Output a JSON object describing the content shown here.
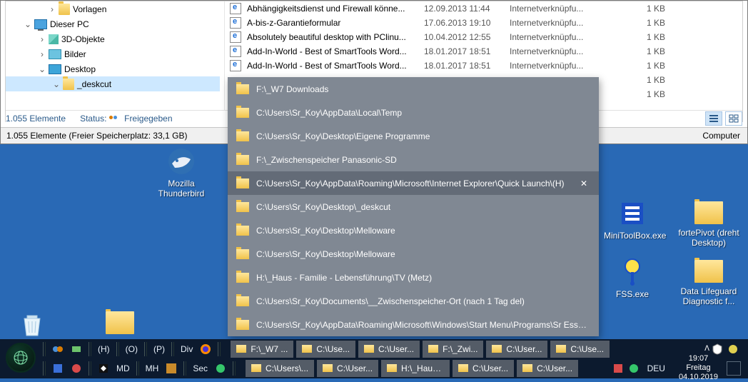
{
  "tree": [
    {
      "indent": 58,
      "exp": "›",
      "icon": "folder",
      "label": "Vorlagen"
    },
    {
      "indent": 24,
      "exp": "⌄",
      "icon": "pc",
      "label": "Dieser PC"
    },
    {
      "indent": 44,
      "exp": "›",
      "icon": "cube",
      "label": "3D-Objekte"
    },
    {
      "indent": 44,
      "exp": "›",
      "icon": "pic",
      "label": "Bilder"
    },
    {
      "indent": 44,
      "exp": "⌄",
      "icon": "desk",
      "label": "Desktop"
    },
    {
      "indent": 64,
      "exp": "⌄",
      "icon": "folder",
      "label": "_deskcut",
      "sel": true
    }
  ],
  "files": [
    {
      "name": "Abhängigkeitsdienst und Firewall könne...",
      "date": "12.09.2013 11:44",
      "type": "Internetverknüpfu...",
      "size": "1 KB"
    },
    {
      "name": "A-bis-z-Garantieformular",
      "date": "17.06.2013 19:10",
      "type": "Internetverknüpfu...",
      "size": "1 KB"
    },
    {
      "name": "Absolutely beautiful desktop with PClinu...",
      "date": "10.04.2012 12:55",
      "type": "Internetverknüpfu...",
      "size": "1 KB"
    },
    {
      "name": "Add-In-World - Best of SmartTools Word...",
      "date": "18.01.2017 18:51",
      "type": "Internetverknüpfu...",
      "size": "1 KB"
    },
    {
      "name": "Add-In-World - Best of SmartTools Word...",
      "date": "18.01.2017 18:51",
      "type": "Internetverknüpfu...",
      "size": "1 KB"
    },
    {
      "name": "",
      "date": "",
      "type": "",
      "size": "1 KB"
    },
    {
      "name": "",
      "date": "",
      "type": "",
      "size": "1 KB"
    }
  ],
  "status": {
    "count": "1.055 Elemente",
    "status_label": "Status:",
    "status_val": "Freigegeben"
  },
  "bottombar": {
    "left": "1.055 Elemente (Freier Speicherplatz: 33,1 GB)",
    "right": "Computer"
  },
  "popup": [
    {
      "label": "F:\\_W7 Downloads"
    },
    {
      "label": "C:\\Users\\Sr_Koy\\AppData\\Local\\Temp"
    },
    {
      "label": "C:\\Users\\Sr_Koy\\Desktop\\Eigene Programme"
    },
    {
      "label": "F:\\_Zwischenspeicher Panasonic-SD"
    },
    {
      "label": "C:\\Users\\Sr_Koy\\AppData\\Roaming\\Microsoft\\Internet Explorer\\Quick Launch\\(H)",
      "hov": true,
      "close": true
    },
    {
      "label": "C:\\Users\\Sr_Koy\\Desktop\\_deskcut"
    },
    {
      "label": "C:\\Users\\Sr_Koy\\Desktop\\Melloware"
    },
    {
      "label": "C:\\Users\\Sr_Koy\\Desktop\\Melloware"
    },
    {
      "label": "H:\\_Haus - Familie - Lebensführung\\TV (Metz)"
    },
    {
      "label": "C:\\Users\\Sr_Koy\\Documents\\__Zwischenspeicher-Ort (nach 1 Tag del)"
    },
    {
      "label": "C:\\Users\\Sr_Koy\\AppData\\Roaming\\Microsoft\\Windows\\Start Menu\\Programs\\Sr Essen..."
    }
  ],
  "desktop": {
    "thunderbird": "Mozilla Thunderbird",
    "minitool": "MiniToolBox.exe",
    "fortepivot": "fortePivot (dreht Desktop)",
    "fss": "FSS.exe",
    "datalife": "Data Lifeguard Diagnostic f..."
  },
  "taskbar": {
    "row1_texts": [
      "(H)",
      "(O)",
      "(P)",
      "Div"
    ],
    "row2_texts": [
      "MD",
      "MH",
      " ",
      "Sec"
    ],
    "folders1": [
      "F:\\_W7 ...",
      "C:\\Use...",
      "C:\\User...",
      "F:\\_Zwi...",
      "C:\\User...",
      "C:\\Use..."
    ],
    "folders2": [
      "C:\\Users\\...",
      "C:\\User...",
      "H:\\_Haus ...",
      "C:\\User...",
      "C:\\User..."
    ],
    "lang": "DEU",
    "time": "19:07",
    "day": "Freitag",
    "date": "04.10.2019"
  }
}
